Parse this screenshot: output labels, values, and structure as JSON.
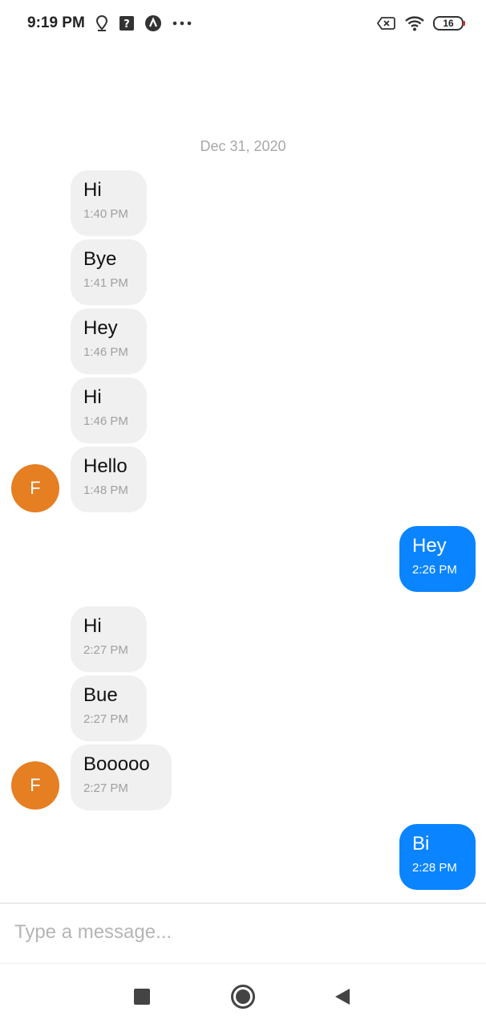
{
  "status_bar": {
    "time": "9:19 PM",
    "icons_left": [
      "location-pin-icon",
      "help-box-icon",
      "app-badge-icon",
      "more-dots-icon"
    ],
    "icons_right": [
      "no-sim-icon",
      "wifi-icon",
      "battery-icon"
    ],
    "battery_level": "16",
    "battery_accent": "#d32f2f"
  },
  "chat": {
    "date_separator": "Dec 31, 2020",
    "contact_initial": "F",
    "avatar_color": "#e67e22",
    "incoming_bubble_color": "#f0f0f0",
    "outgoing_bubble_color": "#0a84ff",
    "messages": [
      {
        "direction": "in",
        "text": "Hi",
        "time": "1:40 PM"
      },
      {
        "direction": "in",
        "text": "Bye",
        "time": "1:41 PM"
      },
      {
        "direction": "in",
        "text": "Hey",
        "time": "1:46 PM"
      },
      {
        "direction": "in",
        "text": "Hi",
        "time": "1:46 PM"
      },
      {
        "direction": "in",
        "text": "Hello",
        "time": "1:48 PM"
      },
      {
        "direction": "out",
        "text": "Hey",
        "time": "2:26 PM"
      },
      {
        "direction": "in",
        "text": "Hi",
        "time": "2:27 PM"
      },
      {
        "direction": "in",
        "text": "Bue",
        "time": "2:27 PM"
      },
      {
        "direction": "in",
        "text": "Booooo",
        "time": "2:27 PM"
      },
      {
        "direction": "out",
        "text": "Bi",
        "time": "2:28 PM"
      }
    ]
  },
  "composer": {
    "placeholder": "Type a message...",
    "value": ""
  },
  "nav_bar": {
    "buttons": [
      "recents-square-icon",
      "home-circle-icon",
      "back-triangle-icon"
    ]
  }
}
